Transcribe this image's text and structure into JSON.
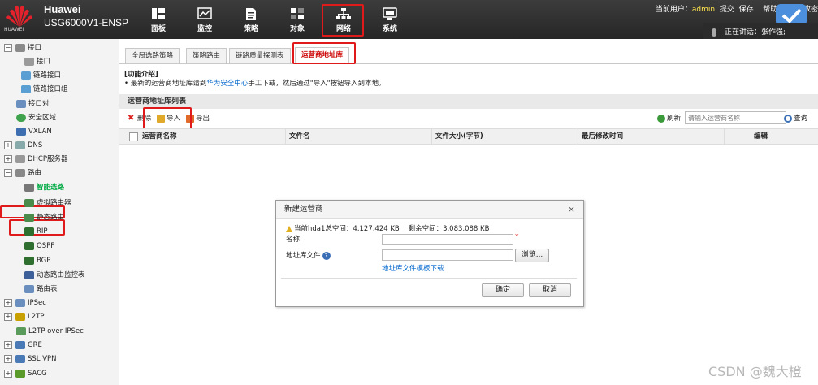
{
  "brand": {
    "logo_text": "HUAWEI",
    "product_line1": "Huawei",
    "product_line2": "USG6000V1-ENSP"
  },
  "nav": [
    {
      "label": "面板",
      "icon": "dashboard-icon"
    },
    {
      "label": "监控",
      "icon": "monitor-icon"
    },
    {
      "label": "策略",
      "icon": "policy-icon"
    },
    {
      "label": "对象",
      "icon": "object-icon"
    },
    {
      "label": "网络",
      "icon": "network-icon",
      "active": true
    },
    {
      "label": "系统",
      "icon": "system-icon"
    }
  ],
  "userbar": {
    "current_user_label": "当前用户：",
    "username": "admin",
    "submit": "提交",
    "save": "保存",
    "help": "帮助",
    "modify": "修改密"
  },
  "speaking": {
    "label": "正在讲话：张作强;"
  },
  "sidebar": {
    "items": [
      {
        "label": "接口",
        "icon": "interface-icon"
      },
      {
        "label": "接口",
        "icon": "interface-icon"
      },
      {
        "label": "链路接口",
        "icon": "link-interface-icon"
      },
      {
        "label": "链路接口组",
        "icon": "link-group-icon"
      },
      {
        "label": "接口对",
        "icon": "interface-pair-icon"
      },
      {
        "label": "安全区域",
        "icon": "security-zone-icon"
      },
      {
        "label": "VXLAN",
        "icon": "vxlan-icon"
      },
      {
        "label": "DNS",
        "icon": "dns-icon"
      },
      {
        "label": "DHCP服务器",
        "icon": "dhcp-icon"
      },
      {
        "label": "路由",
        "icon": "route-icon"
      },
      {
        "label": "智能选路",
        "icon": "smart-route-icon"
      },
      {
        "label": "虚拟路由器",
        "icon": "virtual-router-icon"
      },
      {
        "label": "静态路由",
        "icon": "static-route-icon"
      },
      {
        "label": "RIP",
        "icon": "rip-icon"
      },
      {
        "label": "OSPF",
        "icon": "ospf-icon"
      },
      {
        "label": "BGP",
        "icon": "bgp-icon"
      },
      {
        "label": "动态路由监控表",
        "icon": "dynamic-route-icon"
      },
      {
        "label": "路由表",
        "icon": "route-table-icon"
      },
      {
        "label": "IPSec",
        "icon": "ipsec-icon"
      },
      {
        "label": "L2TP",
        "icon": "l2tp-icon"
      },
      {
        "label": "L2TP over IPSec",
        "icon": "l2tp-ipsec-icon"
      },
      {
        "label": "GRE",
        "icon": "gre-icon"
      },
      {
        "label": "SSL VPN",
        "icon": "ssl-vpn-icon"
      },
      {
        "label": "SACG",
        "icon": "sacg-icon"
      }
    ]
  },
  "tabs": [
    {
      "label": "全局选路策略"
    },
    {
      "label": "策略路由"
    },
    {
      "label": "链路质量探测表"
    },
    {
      "label": "运营商地址库",
      "active": true
    }
  ],
  "func": {
    "title": "[功能介绍]",
    "desc_prefix": "• 最新的运营商地址库请到",
    "desc_link": "华为安全中心",
    "desc_suffix": "手工下载，然后通过\"导入\"按钮导入到本地。"
  },
  "list": {
    "title": "运营商地址库列表"
  },
  "toolbar": {
    "delete": "删除",
    "import": "导入",
    "export": "导出",
    "refresh": "刷新",
    "search_placeholder": "请输入运营商名称",
    "search": "查询"
  },
  "table": {
    "columns": [
      "运营商名称",
      "文件名",
      "文件大小(字节)",
      "最后修改时间",
      "编辑"
    ]
  },
  "dialog": {
    "title": "新建运营商",
    "close": "×",
    "space_info": "当前hda1总空间：4,127,424 KB    剩余空间：3,083,088 KB",
    "name_label": "名称",
    "required_mark": "*",
    "file_label": "地址库文件",
    "browse": "浏览...",
    "template_link": "地址库文件模板下载",
    "confirm": "确定",
    "cancel": "取消"
  },
  "watermark": "CSDN @魏大橙",
  "colors": {
    "highlight_box": "#e01a1a",
    "link": "#0066cc",
    "active_tab_text": "#cc0000"
  }
}
